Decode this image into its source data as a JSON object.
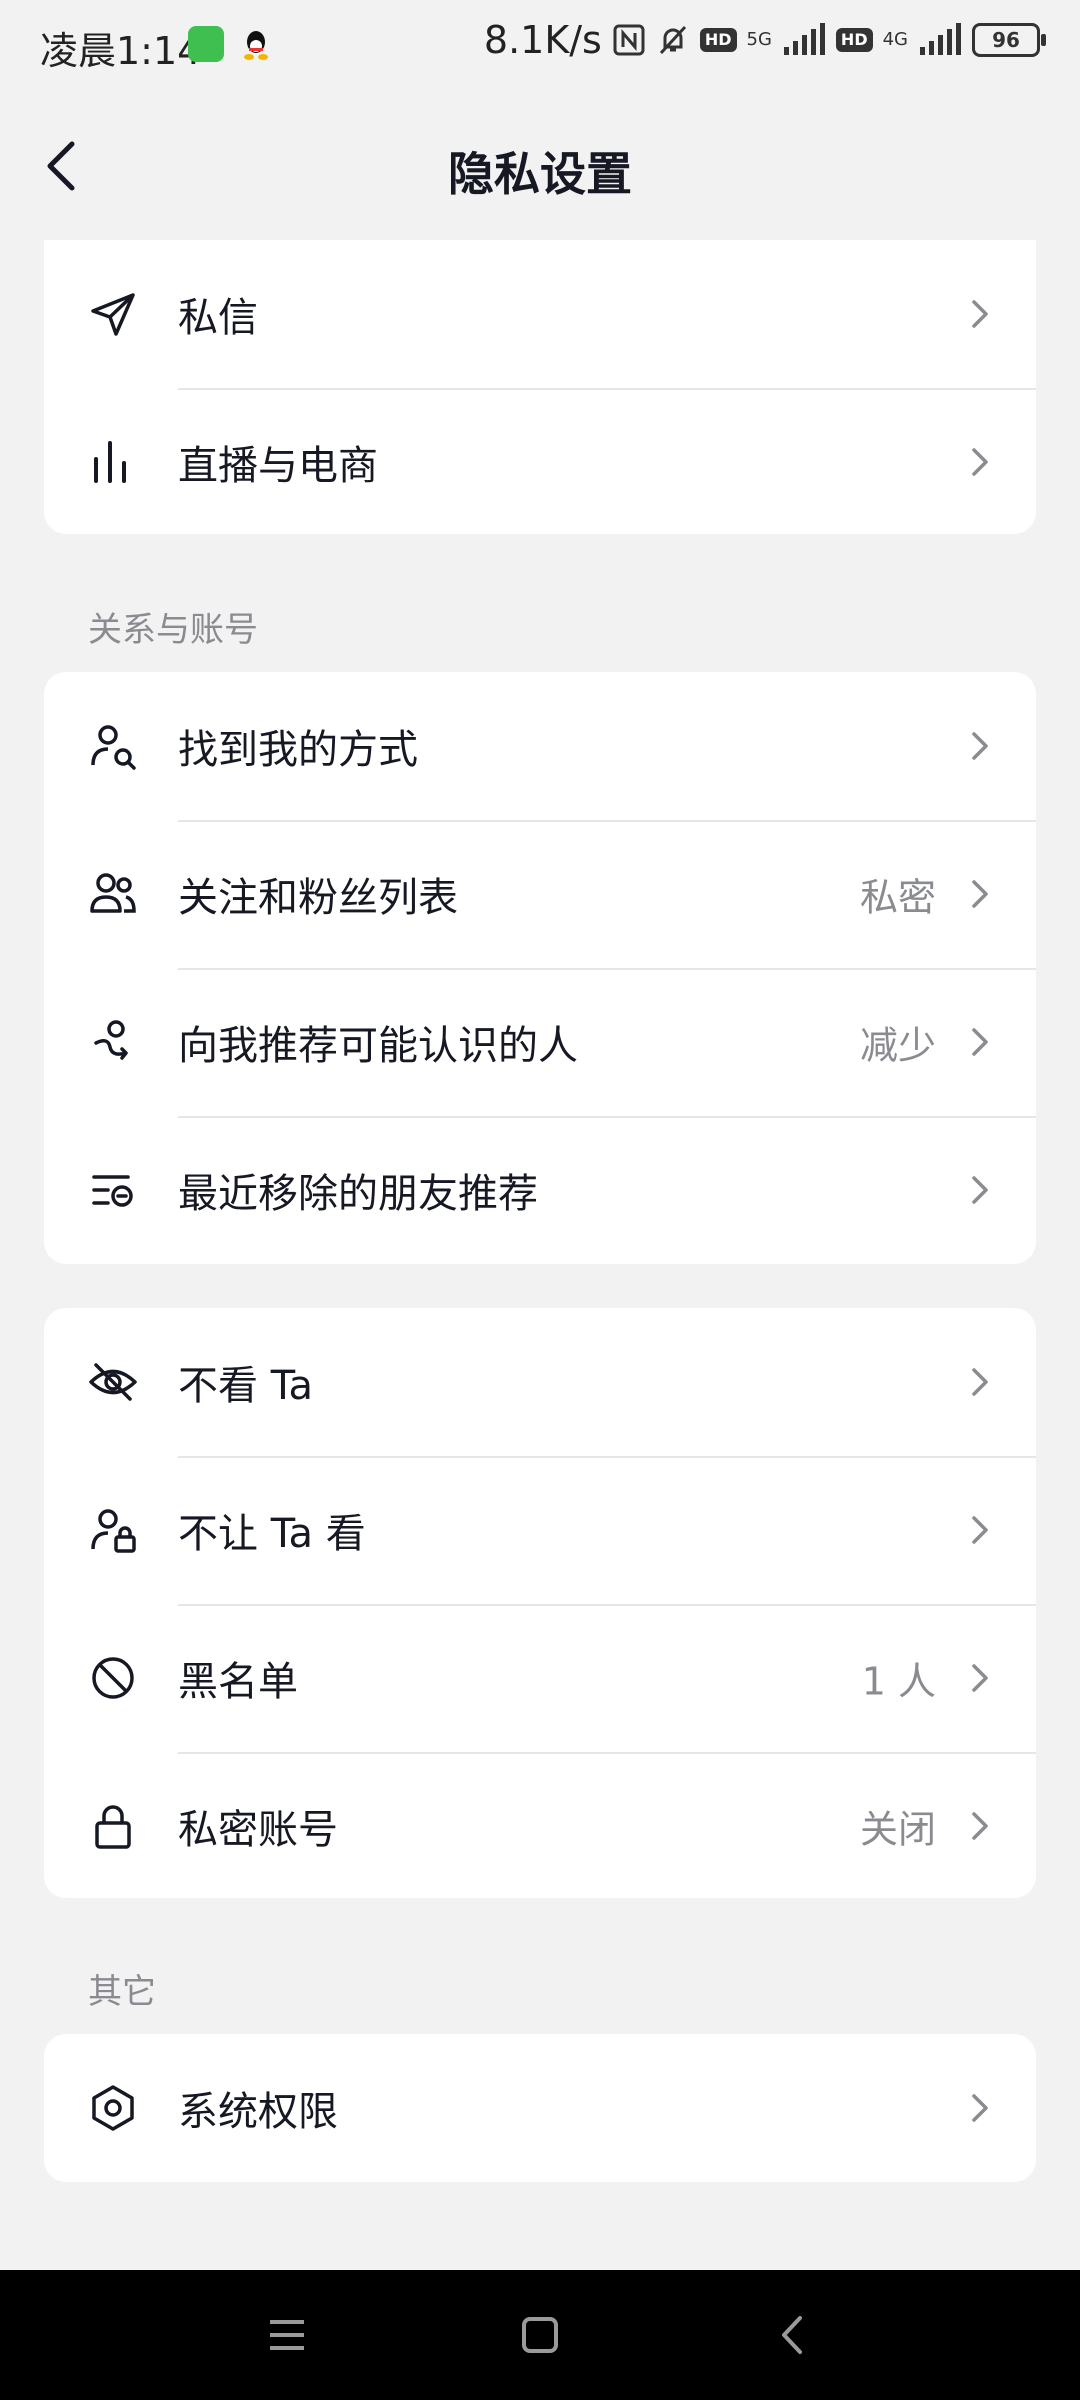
{
  "status_bar": {
    "time": "凌晨1:14",
    "net_speed": "8.1K/s",
    "hd1": "HD",
    "net1": "5G",
    "hd2": "HD",
    "net2": "4G",
    "battery": "96"
  },
  "nav": {
    "title": "隐私设置"
  },
  "group1": {
    "items": [
      {
        "label": "私信",
        "icon": "send-icon"
      },
      {
        "label": "直播与电商",
        "icon": "live-stats-icon"
      }
    ]
  },
  "group2": {
    "title": "关系与账号",
    "items": [
      {
        "label": "找到我的方式",
        "value": "",
        "icon": "find-user-icon"
      },
      {
        "label": "关注和粉丝列表",
        "value": "私密",
        "icon": "users-icon"
      },
      {
        "label": "向我推荐可能认识的人",
        "value": "减少",
        "icon": "recommend-user-icon"
      },
      {
        "label": "最近移除的朋友推荐",
        "value": "",
        "icon": "removed-list-icon"
      }
    ]
  },
  "group3": {
    "items": [
      {
        "label": "不看 Ta",
        "value": "",
        "icon": "eye-off-icon"
      },
      {
        "label": "不让 Ta 看",
        "value": "",
        "icon": "user-lock-icon"
      },
      {
        "label": "黑名单",
        "value": "1 人",
        "icon": "block-icon"
      },
      {
        "label": "私密账号",
        "value": "关闭",
        "icon": "lock-icon"
      }
    ]
  },
  "group4": {
    "title": "其它",
    "items": [
      {
        "label": "系统权限",
        "value": "",
        "icon": "hexagon-settings-icon"
      }
    ]
  },
  "system_nav": {
    "menu": "menu-icon",
    "home": "home-icon",
    "back": "back-icon"
  }
}
